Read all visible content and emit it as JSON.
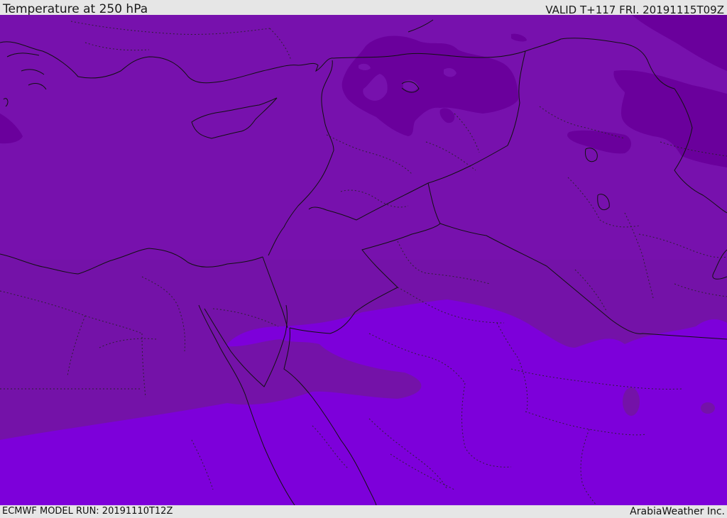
{
  "header": {
    "title": "Temperature at 250 hPa",
    "valid": "VALID T+117 FRI. 20191115T09Z"
  },
  "footer": {
    "model_run": "ECMWF MODEL RUN: 20191110T12Z",
    "brand": "ArabiaWeather Inc."
  },
  "map": {
    "region": "Eastern Mediterranean and Middle East",
    "colors": {
      "cold": "#6a009c",
      "mid": "#7711ad",
      "cooler_band": "#7412a8",
      "warm": "#7d00da",
      "border": "#111111"
    }
  }
}
